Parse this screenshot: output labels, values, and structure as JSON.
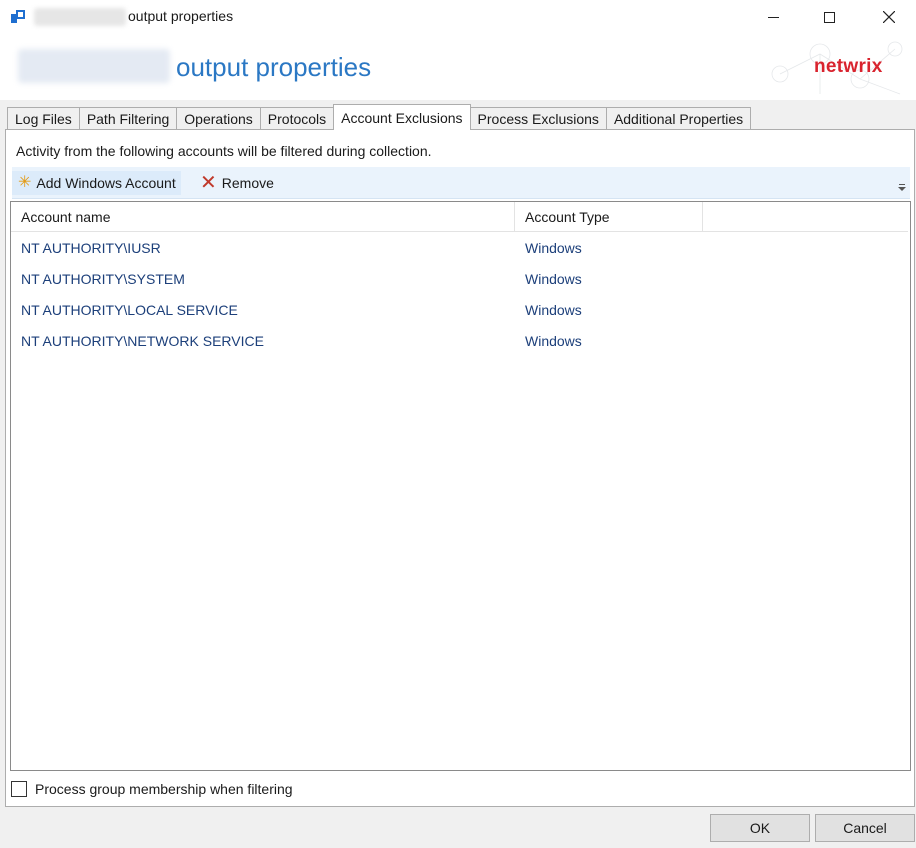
{
  "window": {
    "title": "output properties",
    "header_title": "output properties",
    "brand": "netwrix",
    "accent_color": "#2b78c4",
    "brand_color": "#d9232e"
  },
  "tabs": [
    {
      "label": "Log Files",
      "active": false
    },
    {
      "label": "Path Filtering",
      "active": false
    },
    {
      "label": "Operations",
      "active": false
    },
    {
      "label": "Protocols",
      "active": false
    },
    {
      "label": "Account Exclusions",
      "active": true
    },
    {
      "label": "Process Exclusions",
      "active": false
    },
    {
      "label": "Additional Properties",
      "active": false
    }
  ],
  "panel": {
    "description": "Activity from the following accounts will be filtered during collection.",
    "toolbar": {
      "add_label": "Add Windows Account",
      "remove_label": "Remove"
    },
    "grid": {
      "columns": [
        "Account name",
        "Account Type"
      ],
      "rows": [
        {
          "name": "NT AUTHORITY\\IUSR",
          "type": "Windows"
        },
        {
          "name": "NT AUTHORITY\\SYSTEM",
          "type": "Windows"
        },
        {
          "name": "NT AUTHORITY\\LOCAL SERVICE",
          "type": "Windows"
        },
        {
          "name": "NT AUTHORITY\\NETWORK SERVICE",
          "type": "Windows"
        }
      ]
    },
    "checkbox": {
      "label": "Process group membership when filtering",
      "checked": false
    }
  },
  "buttons": {
    "ok": "OK",
    "cancel": "Cancel"
  }
}
